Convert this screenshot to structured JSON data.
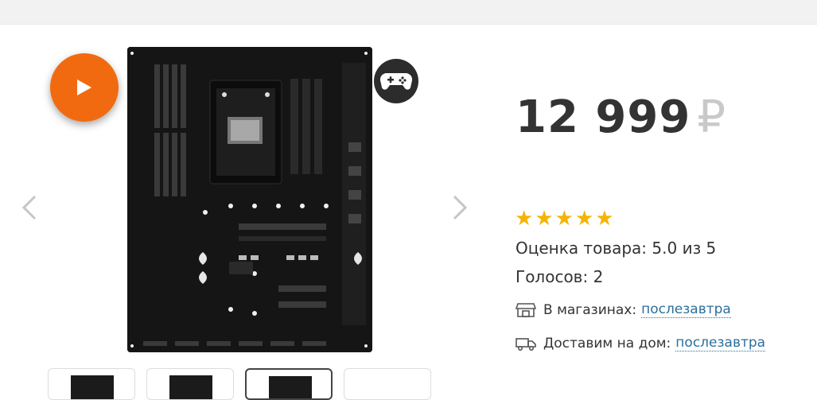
{
  "gallery": {
    "main_image_icon": "motherboard-image",
    "play_icon": "play-icon",
    "badge_icon": "gamepad-icon",
    "prev_icon": "chevron-left-icon",
    "next_icon": "chevron-right-icon",
    "thumbnail_count": 4,
    "active_thumbnail": 3
  },
  "product": {
    "price": "12 999",
    "currency": "₽",
    "rating_stars": 5,
    "star_glyph": "★",
    "rating_label": "Оценка товара: 5.0 из 5",
    "votes_label": "Голосов: 2"
  },
  "delivery": {
    "store_label": "В магазинах:",
    "store_value": "послезавтра",
    "store_icon": "store-icon",
    "home_label": "Доставим на дом:",
    "home_value": "послезавтра",
    "home_icon": "truck-icon"
  },
  "colors": {
    "accent": "#f26a10",
    "star": "#f5b400",
    "link": "#2b6f9c",
    "text": "#333333",
    "currency": "#c9c9c9"
  }
}
